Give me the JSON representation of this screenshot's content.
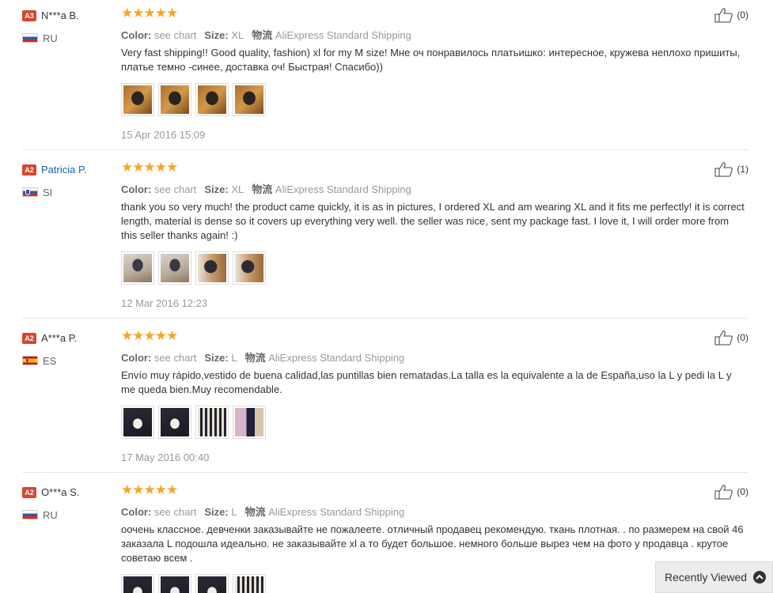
{
  "labels": {
    "color": "Color:",
    "size": "Size:",
    "logistics": "物流",
    "stars": "★★★★★"
  },
  "reviews": [
    {
      "level": "A3",
      "name": "N***a B.",
      "country": "RU",
      "color": "see chart",
      "size": "XL",
      "shipping": "AliExpress Standard Shipping",
      "text": "Very fast shipping!! Good quality, fashion) xl for my M size! Мне оч понравилось платьишко: интересное, кружева неплохо пришиты, платье темно -синее, доставка оч! Быстрая! Спасибо))",
      "date": "15 Apr 2016 15:09",
      "helpful": "(0)",
      "rating": 5
    },
    {
      "level": "A2",
      "name": "Patricia P.",
      "country": "SI",
      "color": "see chart",
      "size": "XL",
      "shipping": "AliExpress Standard Shipping",
      "text": "thank you so very much! the product came quickly, it is as in pictures, I ordered XL and am wearing XL and it fits me perfectly! it is correct length, material is dense so it covers up everything very well. the seller was nice, sent my package fast. I love it, I will order more from this seller thanks again! :)",
      "date": "12 Mar 2016 12:23",
      "helpful": "(1)",
      "rating": 5
    },
    {
      "level": "A2",
      "name": "A***a P.",
      "country": "ES",
      "color": "see chart",
      "size": "L",
      "shipping": "AliExpress Standard Shipping",
      "text": "Envío muy rápido,vestido de buena calidad,las puntillas bien rematadas.La talla es la equivalente a la de España,uso la L y pedi la L y me queda bien.Muy recomendable.",
      "date": "17 May 2016 00:40",
      "helpful": "(0)",
      "rating": 5
    },
    {
      "level": "A2",
      "name": "O***a S.",
      "country": "RU",
      "color": "see chart",
      "size": "L",
      "shipping": "AliExpress Standard Shipping",
      "text": "оочень классное. девченки заказывайте не пожалеете. отличный продавец рекомендую. ткань плотная. . по размерем на свой 46 заказала L подошла идеально. не заказывайте xl а то будет большое. немного больше вырез чем на фото у продавца . крутое советаю всем .",
      "date": "",
      "helpful": "(0)",
      "rating": 5
    }
  ],
  "recently_viewed": "Recently Viewed"
}
